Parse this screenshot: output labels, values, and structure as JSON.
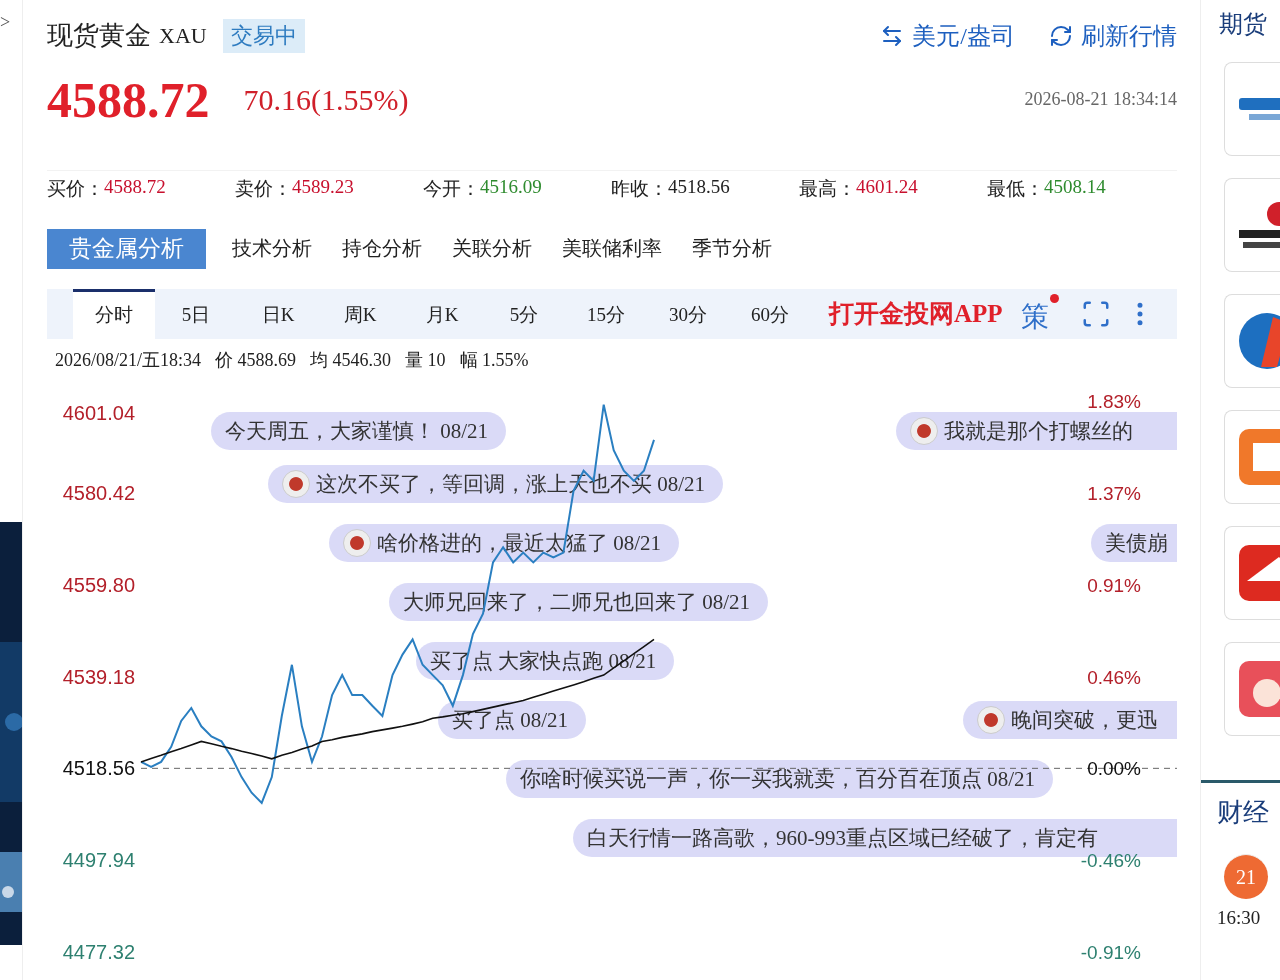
{
  "left_strip": {
    "toggle": ">"
  },
  "header": {
    "title": "现货黄金",
    "symbol": "XAU",
    "status": "交易中",
    "unit_link": "美元/盎司",
    "refresh_link": "刷新行情"
  },
  "quote": {
    "price": "4588.72",
    "change": "70.16(1.55%)",
    "timestamp": "2026-08-21 18:34:14"
  },
  "stats": [
    {
      "label": "买价：",
      "value": "4588.72",
      "color": "#c8102e"
    },
    {
      "label": "卖价：",
      "value": "4589.23",
      "color": "#c8102e"
    },
    {
      "label": "今开：",
      "value": "4516.09",
      "color": "#2e8b2e"
    },
    {
      "label": "昨收：",
      "value": "4518.56",
      "color": "#222222"
    },
    {
      "label": "最高：",
      "value": "4601.24",
      "color": "#c8102e"
    },
    {
      "label": "最低：",
      "value": "4508.14",
      "color": "#2e8b2e"
    }
  ],
  "analysis_tabs": [
    {
      "label": "贵金属分析",
      "selected": true
    },
    {
      "label": "技术分析",
      "selected": false
    },
    {
      "label": "持仓分析",
      "selected": false
    },
    {
      "label": "关联分析",
      "selected": false
    },
    {
      "label": "美联储利率",
      "selected": false
    },
    {
      "label": "季节分析",
      "selected": false
    }
  ],
  "period_tabs": [
    {
      "label": "分时",
      "selected": true
    },
    {
      "label": "5日",
      "selected": false
    },
    {
      "label": "日K",
      "selected": false
    },
    {
      "label": "周K",
      "selected": false
    },
    {
      "label": "月K",
      "selected": false
    },
    {
      "label": "5分",
      "selected": false
    },
    {
      "label": "15分",
      "selected": false
    },
    {
      "label": "30分",
      "selected": false
    },
    {
      "label": "60分",
      "selected": false
    }
  ],
  "toolbar": {
    "app_link": "打开金投网APP",
    "strategy": "策",
    "has_notification": true
  },
  "info_line": [
    {
      "text": "2026/08/21/五18:34"
    },
    {
      "text": "价 4588.69"
    },
    {
      "text": "均 4546.30"
    },
    {
      "text": "量 10"
    },
    {
      "text": "幅 1.55%"
    }
  ],
  "chart": {
    "chart_data": {
      "type": "line",
      "categories": [
        null,
        null,
        null,
        null,
        null,
        null,
        null,
        null,
        null,
        null,
        null,
        null,
        null,
        null,
        null,
        null,
        null,
        null,
        null,
        null,
        null,
        null,
        null,
        null,
        null,
        null,
        null,
        null,
        null,
        null,
        null,
        null,
        null,
        null,
        null,
        null,
        null,
        null,
        null,
        null,
        null,
        null,
        null,
        null,
        null,
        null,
        null,
        null,
        null,
        null,
        null,
        null,
        null,
        null,
        null,
        null,
        null,
        null,
        null,
        null,
        null,
        null,
        null,
        null,
        null,
        null,
        null,
        null,
        null,
        null,
        null,
        null,
        null,
        null,
        null,
        null,
        null,
        null,
        null,
        null,
        null,
        null,
        null,
        null,
        null,
        null,
        null,
        null,
        null,
        null,
        null,
        null,
        null,
        null,
        null,
        null,
        null,
        null,
        null,
        null,
        null,
        null,
        null,
        null
      ],
      "yticks": [
        {
          "value": 4601.04,
          "label": "4601.04"
        },
        {
          "value": 4580.42,
          "label": "4580.42"
        },
        {
          "value": 4559.8,
          "label": "4559.80"
        },
        {
          "value": 4539.18,
          "label": "4539.18"
        },
        {
          "value": 4518.56,
          "label": "4518.56"
        },
        {
          "value": 4497.94,
          "label": "4497.94"
        },
        {
          "value": 4477.32,
          "label": "4477.32"
        }
      ],
      "ylim": [
        4477.32,
        4601.04
      ],
      "series": [
        {
          "color": "#2a7fc1",
          "values": [
            4520.0,
            4518.9,
            4520.0,
            4523.4,
            4529.2,
            4532.1,
            4528.0,
            4525.7,
            4524.6,
            4521.1,
            4516.6,
            4513.1,
            4510.8,
            4516.6,
            4530.3,
            4541.8,
            4528.0,
            4520.0,
            4525.7,
            4535.0,
            4539.5,
            4535.0,
            4535.0,
            4532.6,
            4530.3,
            4539.5,
            4544.1,
            4547.5,
            4541.8,
            4539.5,
            4537.2,
            4532.6,
            4539.5,
            4548.7,
            4553.3,
            4564.8,
            4568.2,
            4564.8,
            4567.0,
            4564.8,
            4567.0,
            4565.9,
            4567.0,
            4580.8,
            4585.4,
            4583.1,
            4600.2,
            4590.0,
            4585.4,
            4583.1,
            4585.4,
            4592.3,
            null,
            null,
            null,
            null,
            null,
            null,
            null,
            null,
            null,
            null,
            null,
            null,
            null,
            null,
            null,
            null,
            null,
            null,
            null,
            null,
            null,
            null,
            null,
            null,
            null,
            null,
            null,
            null,
            null,
            null,
            null,
            null,
            null,
            null,
            null,
            null,
            null,
            null,
            null,
            null,
            null,
            null,
            null,
            null,
            null,
            null,
            null,
            null,
            null,
            null,
            null,
            null
          ]
        },
        {
          "color": "#111111",
          "values": [
            4520.0,
            4520.8,
            4521.5,
            4522.3,
            4523.0,
            4523.8,
            4524.6,
            4524.1,
            4523.5,
            4523.0,
            4522.4,
            4521.9,
            4521.3,
            4520.7,
            4521.5,
            4522.1,
            4522.9,
            4523.6,
            4524.6,
            4525.0,
            4525.5,
            4525.9,
            4526.3,
            4526.8,
            4527.2,
            4527.6,
            4528.0,
            4528.5,
            4529.0,
            4529.8,
            4530.1,
            4530.5,
            4530.8,
            4531.3,
            4531.8,
            4532.3,
            4532.8,
            4533.3,
            4533.8,
            4534.5,
            4535.2,
            4535.9,
            4536.6,
            4537.3,
            4538.0,
            4538.8,
            4539.5,
            4541.1,
            4542.7,
            4544.3,
            4545.9,
            4547.5,
            null,
            null,
            null,
            null,
            null,
            null,
            null,
            null,
            null,
            null,
            null,
            null,
            null,
            null,
            null,
            null,
            null,
            null,
            null,
            null,
            null,
            null,
            null,
            null,
            null,
            null,
            null,
            null,
            null,
            null,
            null,
            null,
            null,
            null,
            null,
            null,
            null,
            null,
            null,
            null,
            null,
            null,
            null,
            null,
            null,
            null,
            null,
            null,
            null,
            null,
            null,
            null
          ]
        }
      ]
    },
    "pct_ticks": [
      "1.83%",
      "1.37%",
      "0.91%",
      "0.46%",
      "0.00%",
      "-0.46%",
      "-0.91%"
    ],
    "comments": [
      {
        "text": "今天周五，大家谨慎！ 08/21",
        "avatar": false
      },
      {
        "text": "我就是那个打螺丝的",
        "avatar": true
      },
      {
        "text": "这次不买了，等回调，涨上天也不买 08/21",
        "avatar": true
      },
      {
        "text": "啥价格进的，最近太猛了 08/21",
        "avatar": true
      },
      {
        "text": "美债崩",
        "avatar": false
      },
      {
        "text": "大师兄回来了，二师兄也回来了 08/21",
        "avatar": false
      },
      {
        "text": "买了点 大家快点跑 08/21",
        "avatar": false
      },
      {
        "text": "买了点 08/21",
        "avatar": false
      },
      {
        "text": "晚间突破，更迅",
        "avatar": true
      },
      {
        "text": "你啥时候买说一声，你一买我就卖，百分百在顶点 08/21",
        "avatar": false
      },
      {
        "text": "白天行情一路高歌，960-993重点区域已经破了，肯定有",
        "avatar": false
      }
    ]
  },
  "right_sidebar": {
    "title": "期货",
    "news_title": "财经",
    "date_badge": "21",
    "time": "16:30"
  }
}
